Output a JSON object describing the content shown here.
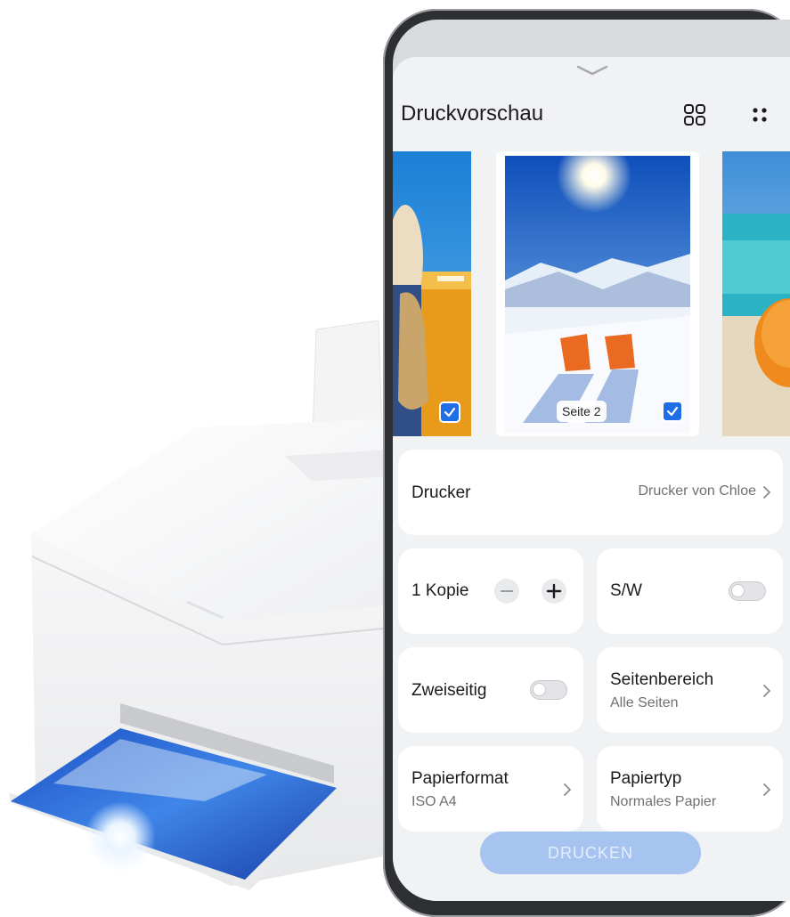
{
  "app": {
    "title": "Druckvorschau"
  },
  "header_icons": [
    "grid-view-icon",
    "more-options-icon"
  ],
  "preview": {
    "current_page_label": "Seite 2",
    "pages": [
      {
        "selected": true
      },
      {
        "selected": true
      },
      {
        "selected": false
      }
    ]
  },
  "settings": {
    "printer": {
      "label": "Drucker",
      "value": "Drucker von Chloe"
    },
    "copies": {
      "label": "1 Kopie"
    },
    "bw": {
      "label": "S/W",
      "on": false
    },
    "duplex": {
      "label": "Zweiseitig",
      "on": false
    },
    "page_range": {
      "label": "Seitenbereich",
      "value": "Alle Seiten"
    },
    "paper_size": {
      "label": "Papierformat",
      "value": "ISO A4"
    },
    "paper_type": {
      "label": "Papiertyp",
      "value": "Normales Papier"
    }
  },
  "print_button": {
    "label": "DRUCKEN",
    "enabled": false
  },
  "colors": {
    "accent": "#1f6ee6",
    "button_disabled": "#a7c3ef",
    "sheet_background": "#f1f2f4"
  }
}
